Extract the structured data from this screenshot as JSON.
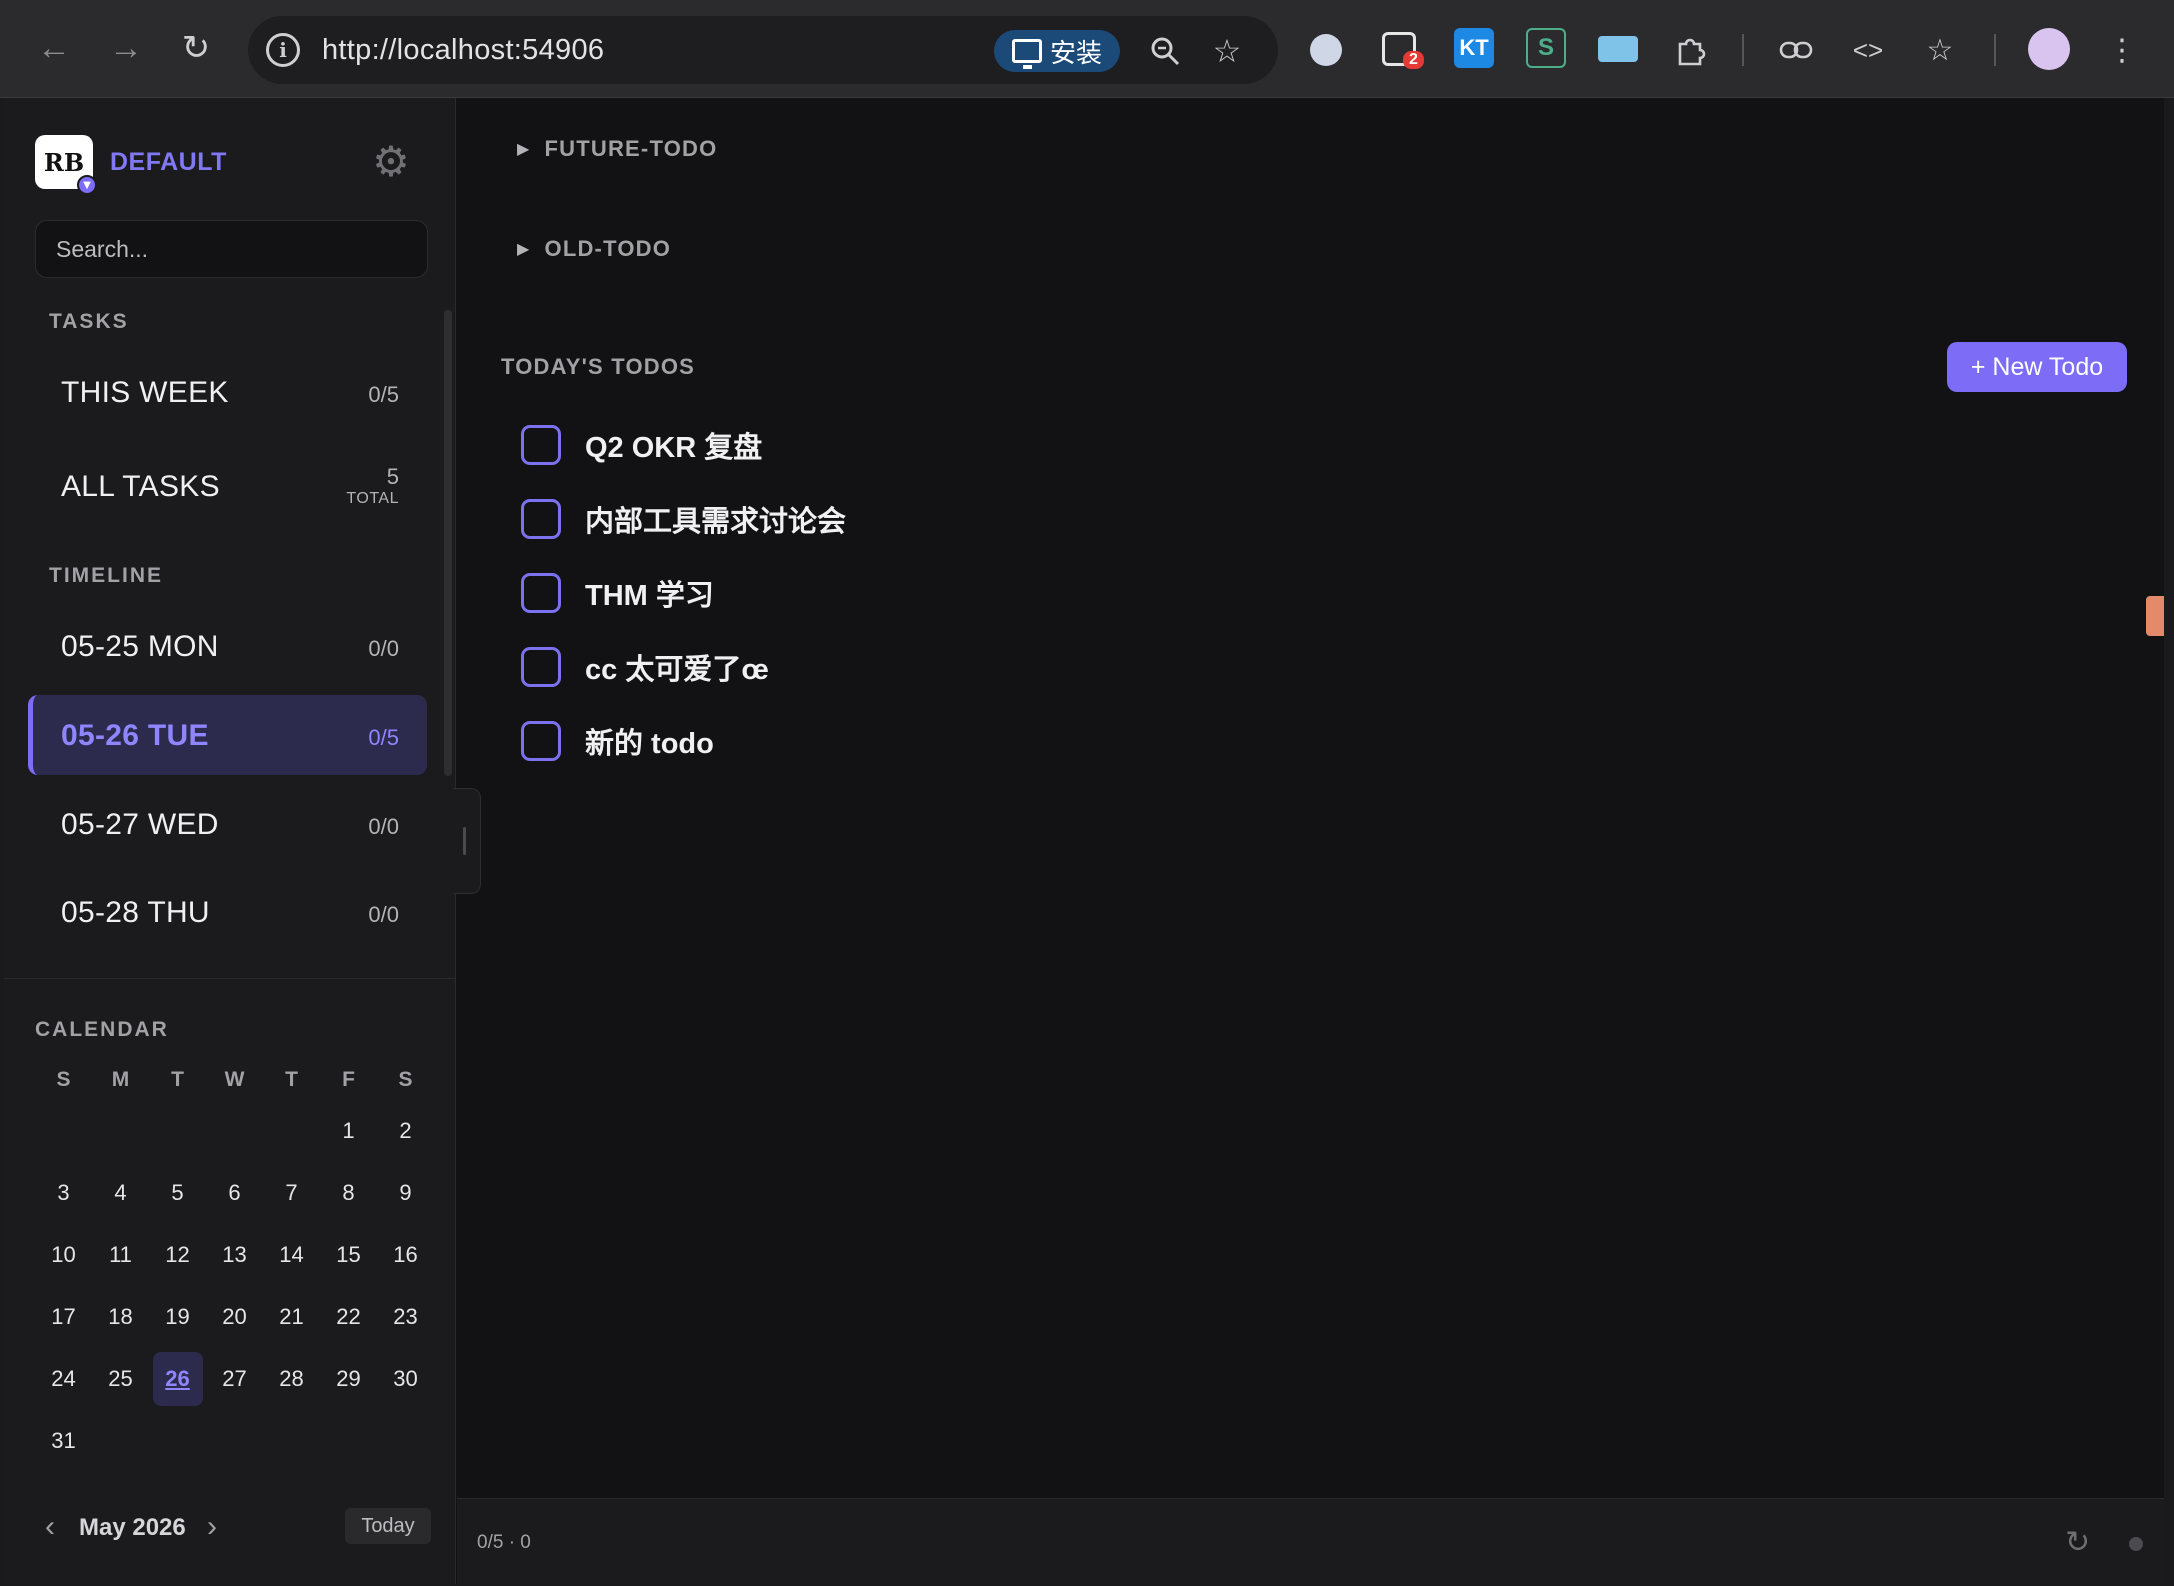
{
  "browser": {
    "url": "http://localhost:54906",
    "install_label": "安装",
    "extension_badge": "2",
    "ext_kt_label": "KT",
    "ext_s_label": "S"
  },
  "sidebar": {
    "workspace_name": "DEFAULT",
    "logo_text": "RB",
    "search_placeholder": "Search...",
    "tasks_title": "TASKS",
    "this_week_label": "THIS WEEK",
    "this_week_count": "0/5",
    "all_tasks_label": "ALL TASKS",
    "all_tasks_total": "5",
    "all_tasks_total_label": "TOTAL",
    "timeline_title": "TIMELINE",
    "timeline": [
      {
        "label": "05-25 MON",
        "count": "0/0"
      },
      {
        "label": "05-26 TUE",
        "count": "0/5"
      },
      {
        "label": "05-27 WED",
        "count": "0/0"
      },
      {
        "label": "05-28 THU",
        "count": "0/0"
      }
    ]
  },
  "calendar": {
    "title": "CALENDAR",
    "weekdays": [
      "S",
      "M",
      "T",
      "W",
      "T",
      "F",
      "S"
    ],
    "weeks": [
      [
        "",
        "",
        "",
        "",
        "",
        "1",
        "2"
      ],
      [
        "3",
        "4",
        "5",
        "6",
        "7",
        "8",
        "9"
      ],
      [
        "10",
        "11",
        "12",
        "13",
        "14",
        "15",
        "16"
      ],
      [
        "17",
        "18",
        "19",
        "20",
        "21",
        "22",
        "23"
      ],
      [
        "24",
        "25",
        "26",
        "27",
        "28",
        "29",
        "30"
      ],
      [
        "31",
        "",
        "",
        "",
        "",
        "",
        ""
      ]
    ],
    "selected_day": "26",
    "month_label": "May 2026",
    "today_button": "Today"
  },
  "main": {
    "future_todo_label": "FUTURE-TODO",
    "old_todo_label": "OLD-TODO",
    "todays_title": "TODAY'S TODOS",
    "new_todo_label": "+ New Todo",
    "todos": [
      "Q2 OKR 复盘",
      "内部工具需求讨论会",
      "THM 学习",
      "cc 太可爱了œ",
      "新的 todo"
    ]
  },
  "status": {
    "text": "0/5 · 0"
  },
  "colors": {
    "accent": "#7c6cf6",
    "background": "#121214",
    "sidebar": "#1b1b1d"
  }
}
